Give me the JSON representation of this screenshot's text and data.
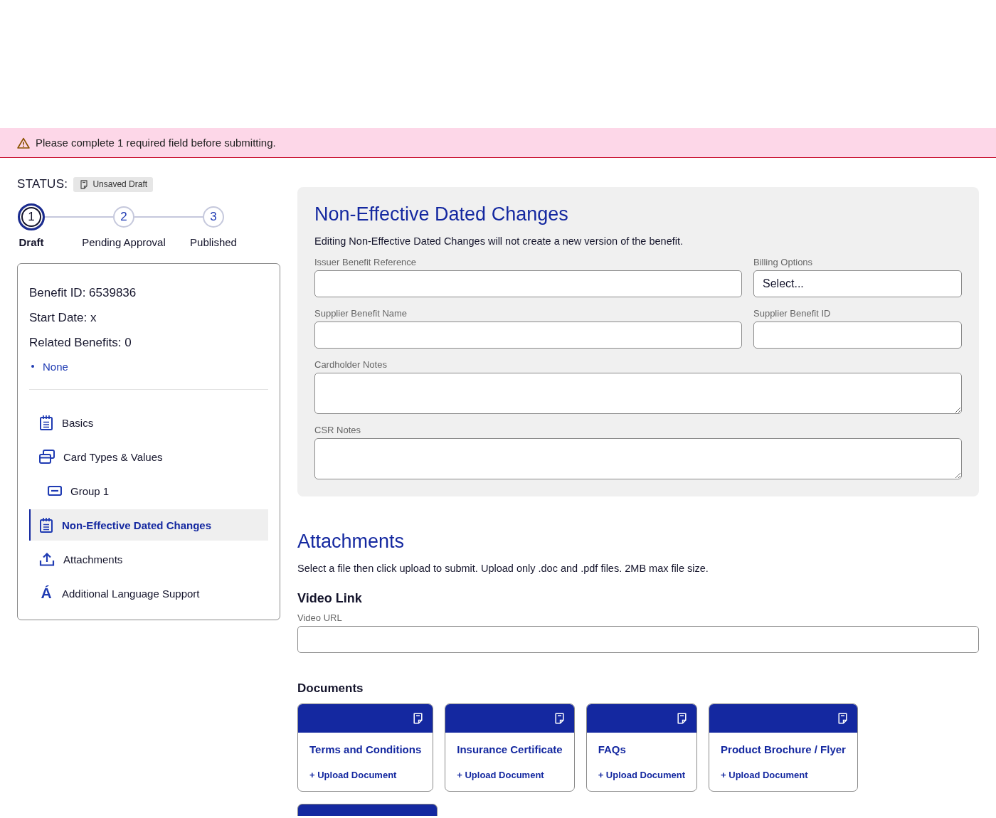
{
  "alert": {
    "text": "Please complete 1 required field before submitting."
  },
  "status": {
    "label": "STATUS:",
    "badge": "Unsaved Draft"
  },
  "steps": [
    {
      "number": "1",
      "label": "Draft",
      "selected": true
    },
    {
      "number": "2",
      "label": "Pending Approval",
      "selected": false
    },
    {
      "number": "3",
      "label": "Published",
      "selected": false
    }
  ],
  "summary": {
    "lines": [
      "Benefit ID: 6539836",
      "Start Date: x",
      "Related Benefits: 0"
    ],
    "related": [
      "None"
    ]
  },
  "nav": [
    {
      "label": "Basics",
      "selected": false
    },
    {
      "label": "Card Types & Values",
      "selected": false,
      "children": [
        {
          "label": "Group 1",
          "selected": false
        }
      ]
    },
    {
      "label": "Non-Effective Dated Changes",
      "selected": true
    },
    {
      "label": "Attachments",
      "selected": false
    },
    {
      "label": "Additional Language Support",
      "glyph": "Á",
      "selected": false
    }
  ],
  "panel": {
    "title": "Non-Effective Dated Changes",
    "description": "Editing Non-Effective Dated Changes will not create a new version of the benefit.",
    "rows": [
      [
        {
          "label": "Issuer Benefit Reference",
          "kind": "input"
        },
        {
          "label": "Billing Options",
          "kind": "select",
          "value": "Select..."
        }
      ],
      [
        {
          "label": "Supplier Benefit Name",
          "kind": "input"
        },
        {
          "label": "Supplier Benefit ID",
          "kind": "input"
        }
      ],
      [
        {
          "label": "Cardholder Notes",
          "kind": "textarea"
        }
      ],
      [
        {
          "label": "CSR Notes",
          "kind": "textarea"
        }
      ]
    ]
  },
  "attachments": {
    "title": "Attachments",
    "description": "Select a file then click upload to submit. Upload only .doc and .pdf files. 2MB max file size.",
    "video": {
      "heading": "Video Link",
      "label": "Video URL"
    },
    "documents": {
      "heading": "Documents",
      "items": [
        {
          "kind": "card",
          "title": "Terms and Conditions",
          "action": "+ Upload Document"
        },
        {
          "kind": "card",
          "title": "Insurance Certificate",
          "action": "+ Upload Document"
        },
        {
          "kind": "card",
          "title": "FAQs",
          "action": "+ Upload Document"
        },
        {
          "kind": "card",
          "title": "Product Brochure / Flyer",
          "action": "+ Upload Document"
        },
        {
          "kind": "cutoff"
        }
      ]
    }
  }
}
